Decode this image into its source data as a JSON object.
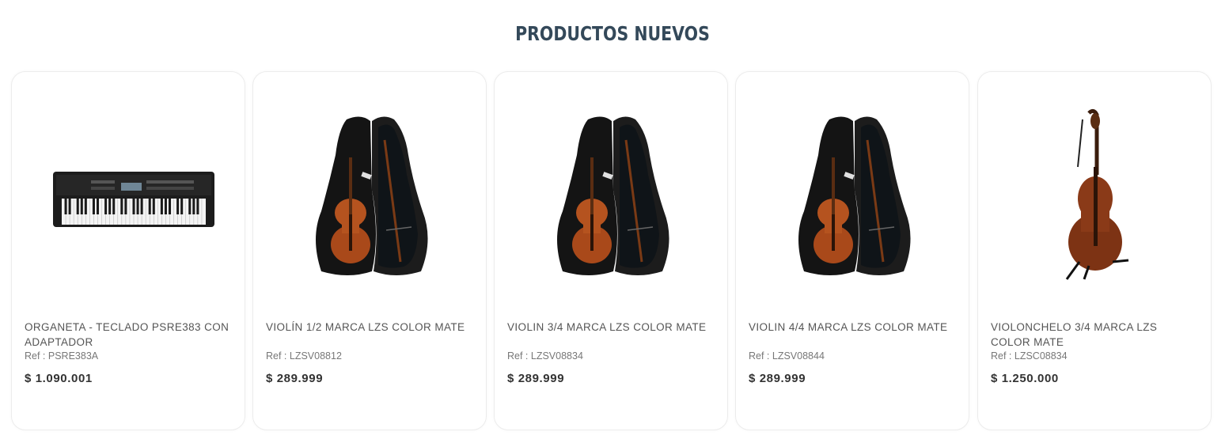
{
  "section": {
    "title": "PRODUCTOS NUEVOS"
  },
  "products": [
    {
      "name": "ORGANETA - TECLADO PSRE383 CON ADAPTADOR",
      "ref": "Ref : PSRE383A",
      "price": "$ 1.090.001",
      "image": "keyboard"
    },
    {
      "name": "VIOLÍN 1/2 MARCA LZS COLOR MATE",
      "ref": "Ref : LZSV08812",
      "price": "$ 289.999",
      "image": "violin-case"
    },
    {
      "name": "VIOLIN 3/4 MARCA LZS COLOR MATE",
      "ref": "Ref : LZSV08834",
      "price": "$ 289.999",
      "image": "violin-case"
    },
    {
      "name": "VIOLIN 4/4 MARCA LZS COLOR MATE",
      "ref": "Ref : LZSV08844",
      "price": "$ 289.999",
      "image": "violin-case"
    },
    {
      "name": "VIOLONCHELO 3/4 MARCA LZS COLOR MATE",
      "ref": "Ref : LZSC08834",
      "price": "$ 1.250.000",
      "image": "cello"
    }
  ]
}
